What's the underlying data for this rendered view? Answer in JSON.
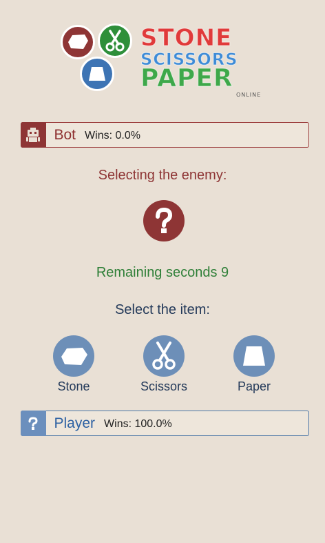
{
  "logo": {
    "line1": "STONE",
    "line2": "SCISSORS",
    "line3": "PAPER",
    "tag": "ONLINE",
    "colors": {
      "stone": "#e03a3a",
      "scissors": "#3e8bd6",
      "paper": "#3ea84a"
    }
  },
  "bot": {
    "name": "Bot",
    "wins": "Wins: 0.0%",
    "icon": "robot-icon",
    "accent": "#8e3535"
  },
  "enemy": {
    "caption": "Selecting the enemy:",
    "icon": "question-icon"
  },
  "timer": {
    "text": "Remaining seconds 9",
    "seconds": 9
  },
  "selection": {
    "caption": "Select the item:",
    "items": [
      {
        "label": "Stone",
        "icon": "stone-icon"
      },
      {
        "label": "Scissors",
        "icon": "scissors-icon"
      },
      {
        "label": "Paper",
        "icon": "paper-icon"
      }
    ]
  },
  "player": {
    "name": "Player",
    "wins": "Wins: 100.0%",
    "icon": "question-icon",
    "accent": "#2e62a3"
  }
}
